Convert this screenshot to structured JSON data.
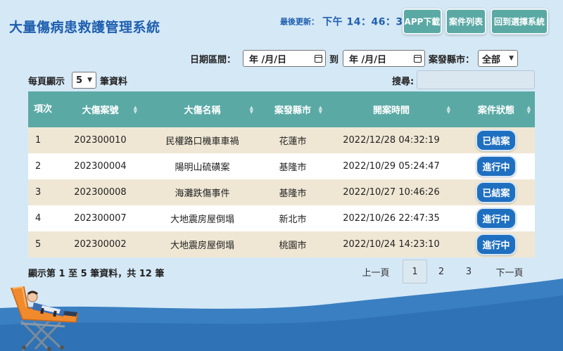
{
  "app": {
    "title": "大量傷病患救護管理系統"
  },
  "header": {
    "updated_label": "最後更新：",
    "updated_time": "下午 14：46：31",
    "buttons": {
      "app_download": "APP下載",
      "case_list": "案件列表",
      "back_to_select": "回到選擇系統"
    }
  },
  "filters": {
    "date_range_label": "日期區間：",
    "date_start": "年 /月/日",
    "to_label": "到",
    "date_end": "年 /月/日",
    "city_label": "案發縣市：",
    "city_value": "全部"
  },
  "list_controls": {
    "per_page_prefix": "每頁顯示",
    "per_page_value": "5",
    "per_page_suffix": "筆資料",
    "search_label": "搜尋:"
  },
  "table": {
    "columns": [
      "項次",
      "大傷案號",
      "大傷名稱",
      "案發縣市",
      "開案時間",
      "案件狀態"
    ],
    "rows": [
      {
        "no": "1",
        "case_id": "202300010",
        "name": "民權路口機車車禍",
        "city": "花蓮市",
        "opened": "2022/12/28 04:32:19",
        "status": "已結案"
      },
      {
        "no": "2",
        "case_id": "202300004",
        "name": "陽明山硫磺案",
        "city": "基隆市",
        "opened": "2022/10/29 05:24:47",
        "status": "進行中"
      },
      {
        "no": "3",
        "case_id": "202300008",
        "name": "海灘跌傷事件",
        "city": "基隆市",
        "opened": "2022/10/27 10:46:26",
        "status": "已結案"
      },
      {
        "no": "4",
        "case_id": "202300007",
        "name": "大地震房屋倒塌",
        "city": "新北市",
        "opened": "2022/10/26 22:47:35",
        "status": "進行中"
      },
      {
        "no": "5",
        "case_id": "202300002",
        "name": "大地震房屋倒塌",
        "city": "桃園市",
        "opened": "2022/10/24 14:23:10",
        "status": "進行中"
      }
    ]
  },
  "footer": {
    "info": "顯示第 1 至 5 筆資料，共 12 筆",
    "pagination": {
      "prev": "上一頁",
      "pages": [
        "1",
        "2",
        "3"
      ],
      "next": "下一頁"
    }
  },
  "colors": {
    "background": "#d5e8f6",
    "title": "#1f5faf",
    "header_teal": "#5aa9a5",
    "row_odd": "#efe7d4",
    "status_badge": "#1e6fc0",
    "wave_dark": "#2f72b5"
  }
}
